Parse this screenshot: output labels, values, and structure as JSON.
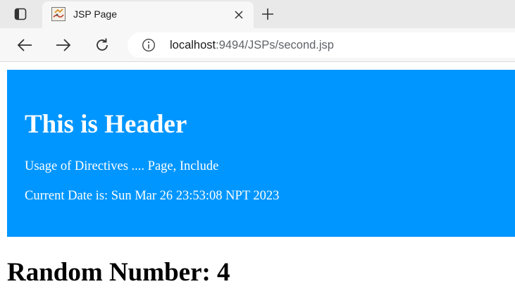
{
  "browser": {
    "tab": {
      "title": "JSP Page",
      "favicon": "java-coffee-cup-icon"
    },
    "address": {
      "host": "localhost",
      "rest": ":9494/JSPs/second.jsp"
    },
    "icons": {
      "tab_actions": "tab-actions-icon",
      "close": "close-icon",
      "new_tab": "plus-icon",
      "back": "back-arrow-icon",
      "forward": "forward-arrow-icon",
      "reload": "reload-icon",
      "site_info": "info-icon"
    }
  },
  "page": {
    "header": {
      "title": "This is Header",
      "usage": "Usage of Directives .... Page, Include",
      "date": "Current Date is: Sun Mar 26 23:53:08 NPT 2023",
      "background": "#0096ff"
    },
    "random": "Random Number: 4"
  }
}
